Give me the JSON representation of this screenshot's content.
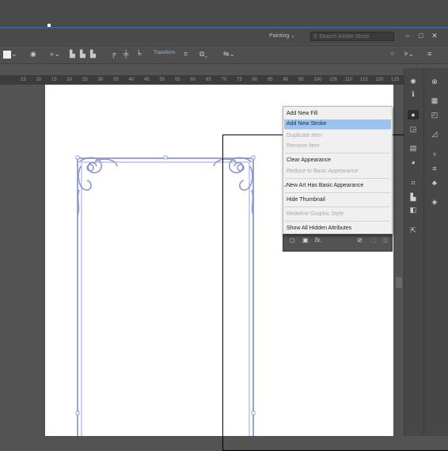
{
  "menubar": {
    "workspace": "Painting",
    "workspace_caret": "⌄",
    "search_placeholder": "Search Adobe Stock",
    "search_icon": "magnifier-icon",
    "minimize": "–",
    "maximize": "□",
    "close": "✕"
  },
  "controlbar": {
    "transform_label": "Transform"
  },
  "ruler": {
    "ticks": [
      "15",
      "10",
      "15",
      "20",
      "25",
      "30",
      "35",
      "40",
      "45",
      "50",
      "55",
      "60",
      "65",
      "70",
      "75",
      "80",
      "85",
      "90",
      "95",
      "100",
      "105",
      "110",
      "115",
      "120",
      "125"
    ]
  },
  "appearance_menu": {
    "items": [
      {
        "label": "Add New Fill",
        "state": "normal"
      },
      {
        "label": "Add New Stroke",
        "state": "highlighted"
      },
      {
        "label": "Duplicate Item",
        "state": "disabled"
      },
      {
        "label": "Remove Item",
        "state": "disabled"
      },
      {
        "label": "Clear Appearance",
        "state": "normal"
      },
      {
        "label": "Reduce to Basic Appearance",
        "state": "disabled"
      },
      {
        "label": "New Art Has Basic Appearance",
        "state": "checked"
      },
      {
        "label": "Hide Thumbnail",
        "state": "normal"
      },
      {
        "label": "Redefine Graphic Style",
        "state": "disabled"
      },
      {
        "label": "Show All Hidden Attributes",
        "state": "normal"
      }
    ],
    "check_mark": "✓"
  },
  "appearance_panel_footer": {
    "fx_label": "fx."
  },
  "colors": {
    "highlight": "#9cc3ef",
    "frame_stroke": "#9aa3d6",
    "accent_line": "#2e5fb2"
  }
}
